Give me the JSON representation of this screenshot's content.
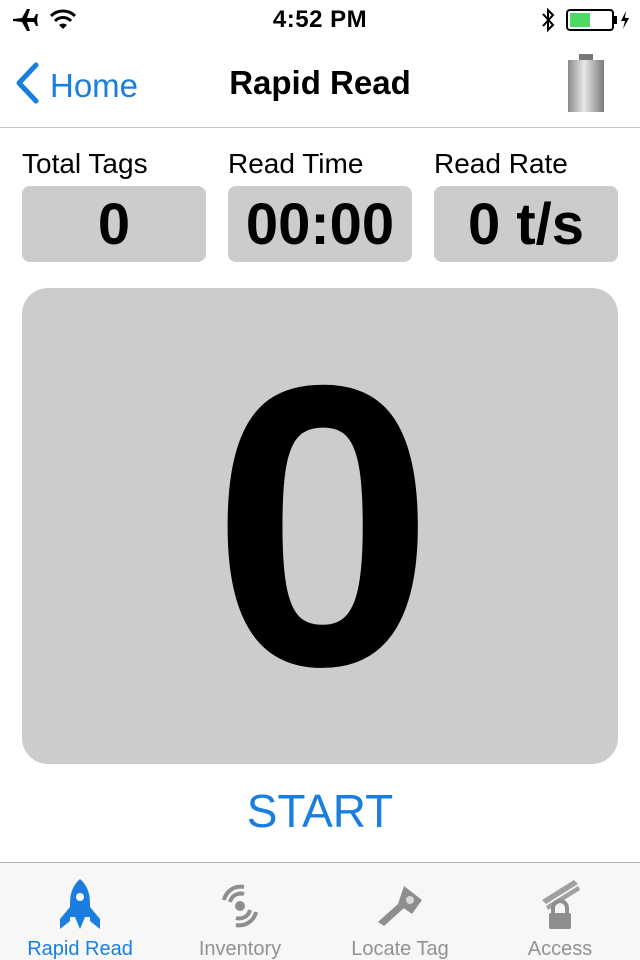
{
  "status_bar": {
    "time": "4:52 PM",
    "battery_color": "#4cd964"
  },
  "nav": {
    "back_label": "Home",
    "title": "Rapid Read"
  },
  "stats": [
    {
      "label": "Total Tags",
      "value": "0"
    },
    {
      "label": "Read Time",
      "value": "00:00"
    },
    {
      "label": "Read Rate",
      "value": "0 t/s"
    }
  ],
  "counter": {
    "value": "0"
  },
  "start_label": "START",
  "tabs": [
    {
      "label": "Rapid Read",
      "icon": "rocket-icon",
      "active": true
    },
    {
      "label": "Inventory",
      "icon": "signal-waves-icon",
      "active": false
    },
    {
      "label": "Locate Tag",
      "icon": "flashlight-icon",
      "active": false
    },
    {
      "label": "Access",
      "icon": "lock-icon",
      "active": false
    }
  ],
  "colors": {
    "accent": "#1a7ee0",
    "panel": "#cccccc",
    "inactive_tab": "#929292"
  }
}
